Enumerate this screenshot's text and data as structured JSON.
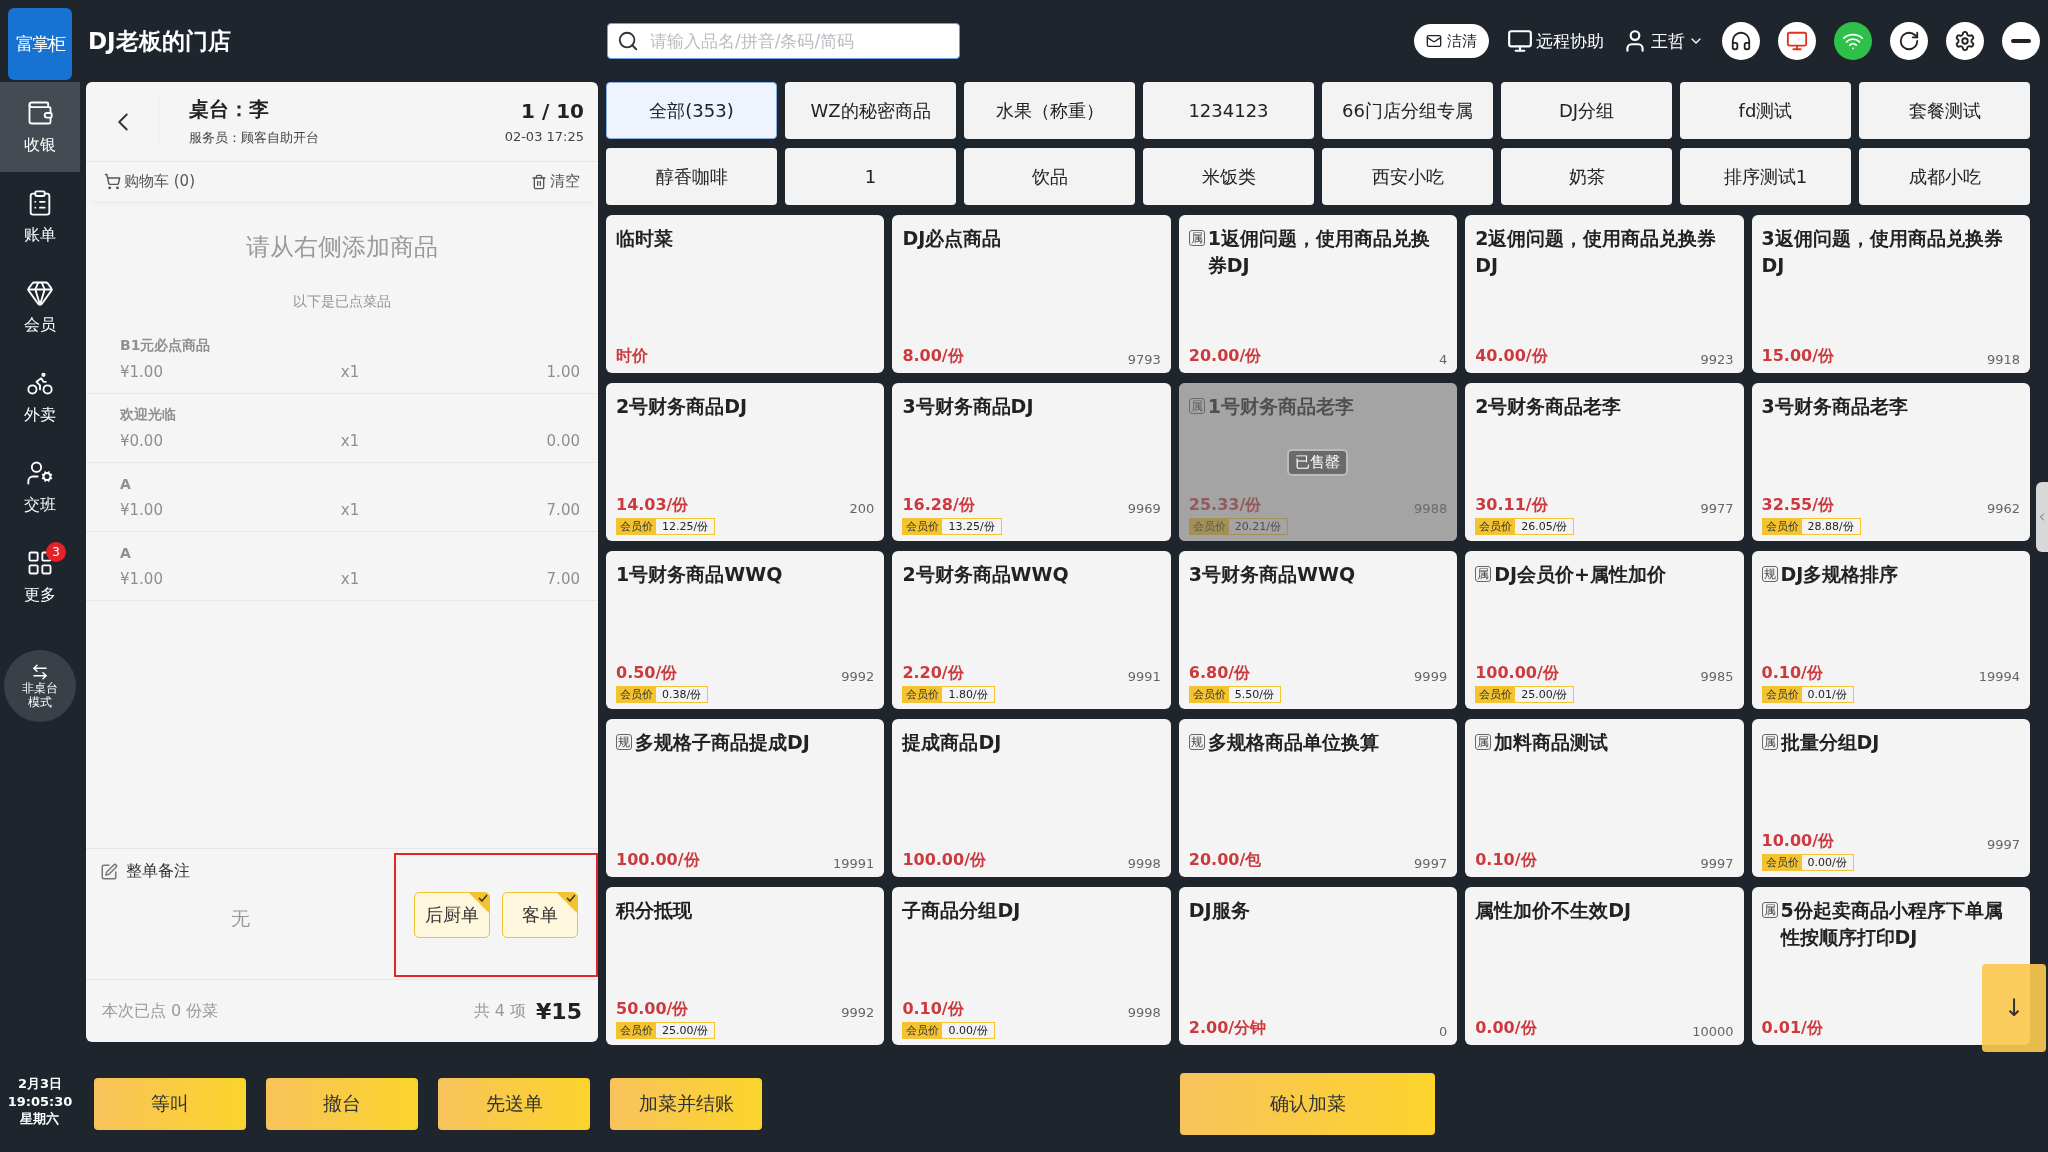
{
  "logo": "富掌柜",
  "store_name": "DJ老板的门店",
  "nav": [
    {
      "label": "收银",
      "selected": true
    },
    {
      "label": "账单",
      "selected": false
    },
    {
      "label": "会员",
      "selected": false
    },
    {
      "label": "外卖",
      "selected": false
    },
    {
      "label": "交班",
      "selected": false
    },
    {
      "label": "更多",
      "selected": false,
      "badge": "3"
    }
  ],
  "mode_button": "非桌台模式",
  "clock": {
    "date": "2月3日",
    "time": "19:05:30",
    "weekday": "星期六"
  },
  "search": {
    "placeholder": "请输入品名/拼音/条码/简码"
  },
  "toolbar": {
    "clean_button": "洁清",
    "remote": "远程协助",
    "user": "王哲"
  },
  "cart": {
    "table": "桌台：李",
    "waiter": "服务员：顾客自助开台",
    "page": "1 / 10",
    "time": "02-03 17:25",
    "cart_label": "购物车 (0)",
    "clear": "清空",
    "empty_hint": "请从右侧添加商品",
    "ordered_hint": "以下是已点菜品",
    "items": [
      {
        "name": "B1元必点商品",
        "unit": "¥1.00",
        "qty": "x1",
        "total": "1.00"
      },
      {
        "name": "欢迎光临",
        "unit": "¥0.00",
        "qty": "x1",
        "total": "0.00"
      },
      {
        "name": "A",
        "unit": "¥1.00",
        "qty": "x1",
        "total": "7.00"
      },
      {
        "name": "A",
        "unit": "¥1.00",
        "qty": "x1",
        "total": "7.00"
      }
    ],
    "remark_label": "整单备注",
    "remark_value": "无",
    "print_options": [
      {
        "label": "后厨单",
        "selected": true
      },
      {
        "label": "客单",
        "selected": true
      }
    ],
    "summary": "本次已点 0 份菜",
    "count": "共 4 项",
    "total": "¥15"
  },
  "categories": [
    {
      "label": "全部(353)",
      "selected": true
    },
    {
      "label": "WZ的秘密商品",
      "selected": false
    },
    {
      "label": "水果（称重）",
      "selected": false
    },
    {
      "label": "1234123",
      "selected": false
    },
    {
      "label": "66门店分组专属",
      "selected": false
    },
    {
      "label": "DJ分组",
      "selected": false
    },
    {
      "label": "fd测试",
      "selected": false
    },
    {
      "label": "套餐测试",
      "selected": false
    },
    {
      "label": "醇香咖啡",
      "selected": false
    },
    {
      "label": "1",
      "selected": false
    },
    {
      "label": "饮品",
      "selected": false
    },
    {
      "label": "米饭类",
      "selected": false
    },
    {
      "label": "西安小吃",
      "selected": false
    },
    {
      "label": "奶茶",
      "selected": false
    },
    {
      "label": "排序测试1",
      "selected": false
    },
    {
      "label": "成都小吃",
      "selected": false
    }
  ],
  "sold_out_label": "已售罄",
  "products": [
    {
      "name": "临时菜",
      "price": "时价",
      "sold_out": false
    },
    {
      "name": "DJ必点商品",
      "price": "8.00/份",
      "stock": "9793",
      "sold_out": false
    },
    {
      "tag": "属",
      "name": "1返佣问题，使用商品兑换券DJ",
      "price": "20.00/份",
      "stock": "4",
      "sold_out": false
    },
    {
      "name": "2返佣问题，使用商品兑换券DJ",
      "price": "40.00/份",
      "stock": "9923",
      "sold_out": false
    },
    {
      "name": "3返佣问题，使用商品兑换券DJ",
      "price": "15.00/份",
      "stock": "9918",
      "sold_out": false
    },
    {
      "name": "2号财务商品DJ",
      "price": "14.03/份",
      "stock": "200",
      "member_price": {
        "label": "会员价",
        "price": "12.25/份"
      },
      "sold_out": false
    },
    {
      "name": "3号财务商品DJ",
      "price": "16.28/份",
      "stock": "9969",
      "member_price": {
        "label": "会员价",
        "price": "13.25/份"
      },
      "sold_out": false
    },
    {
      "tag": "属",
      "name": "1号财务商品老李",
      "price": "25.33/份",
      "stock": "9988",
      "member_price": {
        "label": "会员价",
        "price": "20.21/份"
      },
      "sold_out": true
    },
    {
      "name": "2号财务商品老李",
      "price": "30.11/份",
      "stock": "9977",
      "member_price": {
        "label": "会员价",
        "price": "26.05/份"
      },
      "sold_out": false
    },
    {
      "name": "3号财务商品老李",
      "price": "32.55/份",
      "stock": "9962",
      "member_price": {
        "label": "会员价",
        "price": "28.88/份"
      },
      "sold_out": false
    },
    {
      "name": "1号财务商品WWQ",
      "price": "0.50/份",
      "stock": "9992",
      "member_price": {
        "label": "会员价",
        "price": "0.38/份"
      },
      "sold_out": false
    },
    {
      "name": "2号财务商品WWQ",
      "price": "2.20/份",
      "stock": "9991",
      "member_price": {
        "label": "会员价",
        "price": "1.80/份"
      },
      "sold_out": false
    },
    {
      "name": "3号财务商品WWQ",
      "price": "6.80/份",
      "stock": "9999",
      "member_price": {
        "label": "会员价",
        "price": "5.50/份"
      },
      "sold_out": false
    },
    {
      "tag": "属",
      "name": "DJ会员价+属性加价",
      "price": "100.00/份",
      "stock": "9985",
      "member_price": {
        "label": "会员价",
        "price": "25.00/份"
      },
      "sold_out": false
    },
    {
      "tag": "规",
      "name": "DJ多规格排序",
      "price": "0.10/份",
      "stock": "19994",
      "member_price": {
        "label": "会员价",
        "price": "0.01/份"
      },
      "sold_out": false
    },
    {
      "tag": "规",
      "name": "多规格子商品提成DJ",
      "price": "100.00/份",
      "stock": "19991",
      "sold_out": false
    },
    {
      "name": "提成商品DJ",
      "price": "100.00/份",
      "stock": "9998",
      "sold_out": false
    },
    {
      "tag": "规",
      "name": "多规格商品单位换算",
      "price": "20.00/包",
      "stock": "9997",
      "sold_out": false
    },
    {
      "tag": "属",
      "name": "加料商品测试",
      "price": "0.10/份",
      "stock": "9997",
      "sold_out": false
    },
    {
      "tag": "属",
      "name": "批量分组DJ",
      "price": "10.00/份",
      "stock": "9997",
      "member_price": {
        "label": "会员价",
        "price": "0.00/份"
      },
      "sold_out": false
    },
    {
      "name": "积分抵现",
      "price": "50.00/份",
      "stock": "9992",
      "member_price": {
        "label": "会员价",
        "price": "25.00/份"
      },
      "sold_out": false
    },
    {
      "name": "子商品分组DJ",
      "price": "0.10/份",
      "stock": "9998",
      "member_price": {
        "label": "会员价",
        "price": "0.00/份"
      },
      "sold_out": false
    },
    {
      "name": "DJ服务",
      "price": "2.00/分钟",
      "stock": "0",
      "sold_out": false
    },
    {
      "name": "属性加价不生效DJ",
      "price": "0.00/份",
      "stock": "10000",
      "sold_out": false
    },
    {
      "tag": "属",
      "name": "5份起卖商品小程序下单属性按顺序打印DJ",
      "price": "0.01/份",
      "sold_out": false
    }
  ],
  "scroll_down_button": "↓",
  "actions": [
    {
      "label": "等叫",
      "kind": "left"
    },
    {
      "label": "撤台",
      "kind": "left"
    },
    {
      "label": "先送单",
      "kind": "left"
    },
    {
      "label": "加菜并结账",
      "kind": "left"
    },
    {
      "label": "确认加菜",
      "kind": "primary"
    }
  ]
}
